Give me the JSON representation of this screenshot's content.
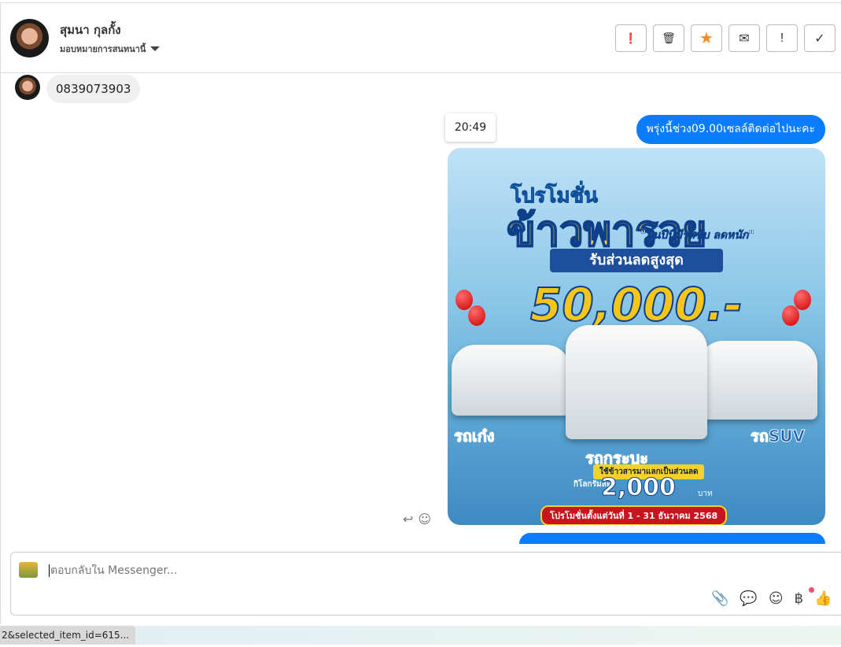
{
  "header": {
    "contact_name": "สุมนา กุลกั้ง",
    "assign_label": "มอบหมายการสนทนานี้",
    "actions": [
      {
        "icon": "alert-circle-icon",
        "glyph": "❗"
      },
      {
        "icon": "trash-icon",
        "glyph": "🗑"
      },
      {
        "icon": "star-icon",
        "glyph": "★",
        "color": "#f28c28"
      },
      {
        "icon": "envelope-icon",
        "glyph": "✉"
      },
      {
        "icon": "exclamation-icon",
        "glyph": "!"
      },
      {
        "icon": "check-icon",
        "glyph": "✓"
      }
    ]
  },
  "messages": {
    "incoming_text": "0839073903",
    "timestamp": "20:49",
    "outgoing_text": "พรุ่งนี้ช่วง09.00เซลล์ติดต่อไปนะคะ",
    "poster": {
      "promo": "โปรโมชั่น",
      "headline": "ข้าวพารวย",
      "tagline": "\"สิ้นปีนี้มีรถขับ ลดหนัก\"",
      "discount_label": "รับส่วนลดสูงสุด",
      "discount_value": "50,000.-",
      "sedan": "รถเก๋ง",
      "pickup": "รถกระบะ",
      "suv": "รถSUV",
      "rice_offer": "ใช้ข้าวสารมาแลกเป็นส่วนลด",
      "per_kg": "กิโลกรัมละ",
      "per_kg_value": "2,000",
      "baht": "บาท",
      "period": "โปรโมชั่นตั้งแต่วันที่ 1 - 31 ธันวาคม 2568"
    }
  },
  "composer": {
    "placeholder": "ตอบกลับใน Messenger...",
    "tools": [
      {
        "icon": "paperclip-icon",
        "glyph": "📎"
      },
      {
        "icon": "chat-icon",
        "glyph": "💬"
      },
      {
        "icon": "smiley-icon",
        "glyph": "☺"
      },
      {
        "icon": "baht-icon",
        "glyph": "฿"
      },
      {
        "icon": "thumbs-up-icon",
        "glyph": "👍"
      }
    ]
  },
  "status_url": "2&selected_item_id=615...",
  "colors": {
    "accent": "#0a7cff",
    "star": "#f28c28"
  }
}
